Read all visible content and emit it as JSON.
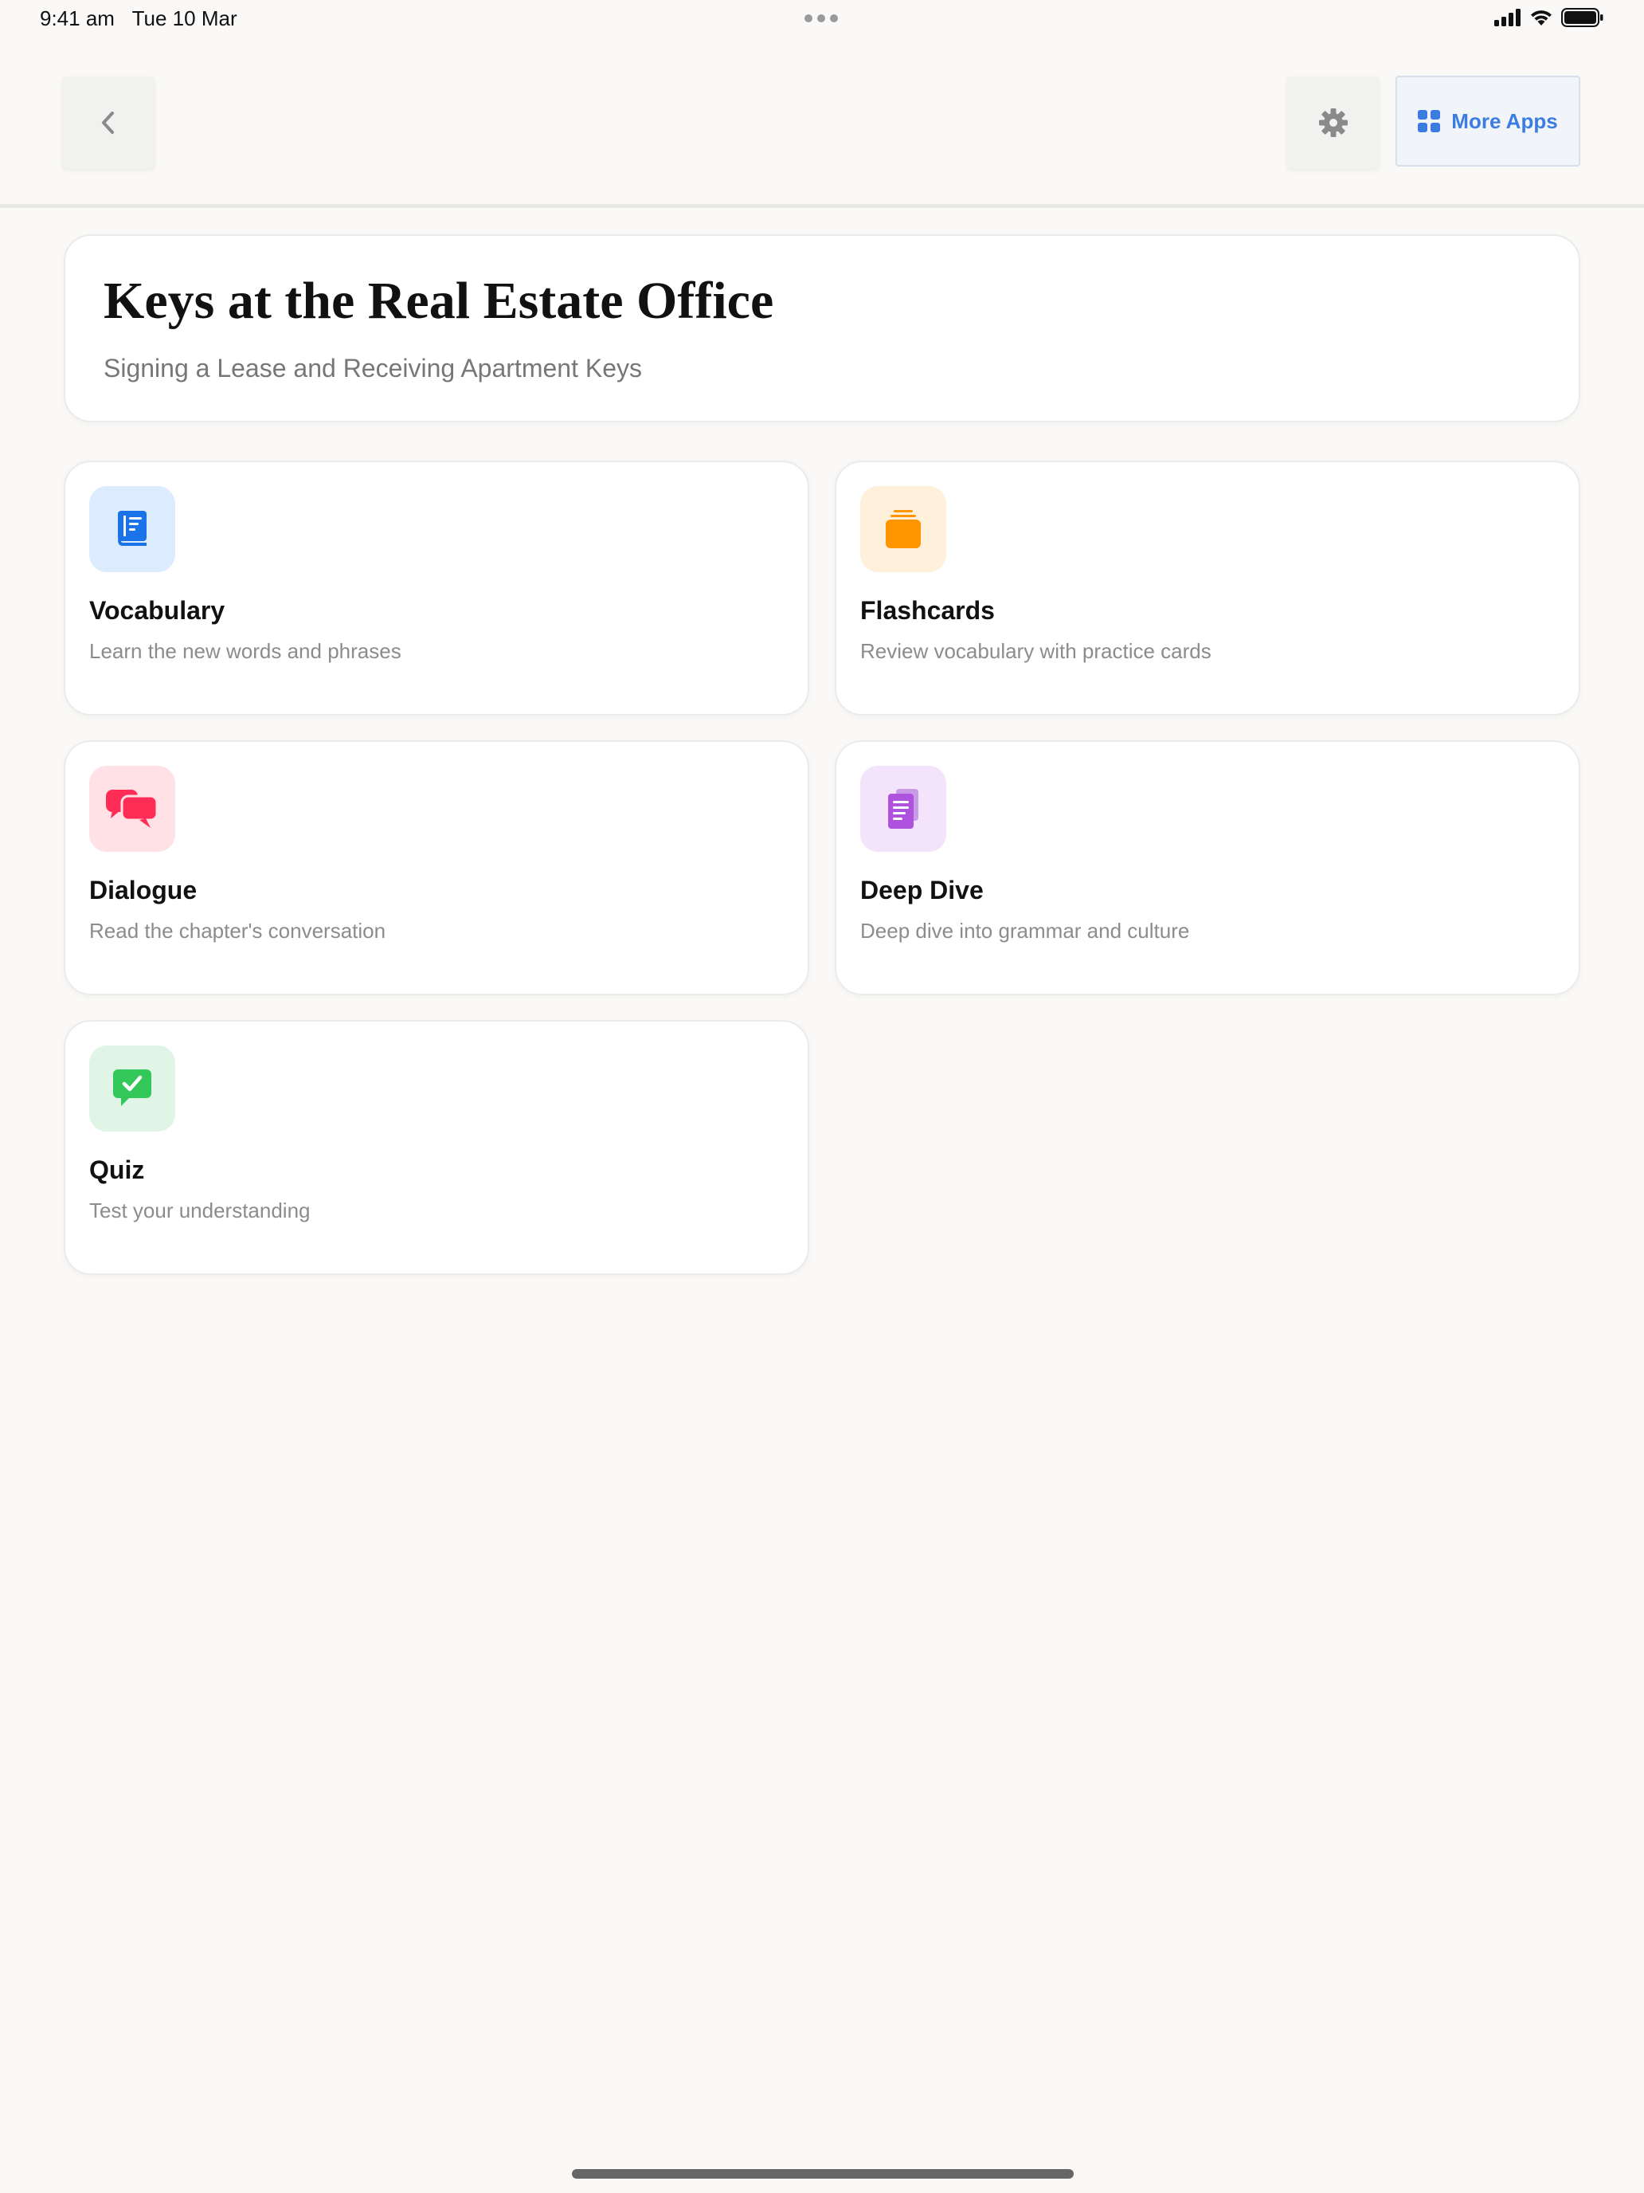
{
  "status_bar": {
    "time": "9:41 am",
    "date": "Tue 10 Mar"
  },
  "header": {
    "back_icon": "chevron-left-icon",
    "settings_icon": "gear-icon",
    "more_apps": {
      "icon": "grid-icon",
      "label": "More Apps",
      "color": "#3b7ce2"
    }
  },
  "lesson": {
    "title": "Keys at the Real Estate Office",
    "subtitle": "Signing a Lease and Receiving Apartment Keys"
  },
  "activities": [
    {
      "id": "vocabulary",
      "icon": "book-icon",
      "title": "Vocabulary",
      "description": "Learn the new words and phrases",
      "accent": "#1a73e8",
      "tile_bg": "#dcebfd"
    },
    {
      "id": "flashcards",
      "icon": "card-stack-icon",
      "title": "Flashcards",
      "description": "Review vocabulary with practice cards",
      "accent": "#ff9500",
      "tile_bg": "#fff0dc"
    },
    {
      "id": "dialogue",
      "icon": "speech-bubbles-icon",
      "title": "Dialogue",
      "description": "Read the chapter's conversation",
      "accent": "#ff2d55",
      "tile_bg": "#ffe1e6"
    },
    {
      "id": "deep-dive",
      "icon": "document-icon",
      "title": "Deep Dive",
      "description": "Deep dive into grammar and culture",
      "accent": "#af52de",
      "tile_bg": "#f3e4fb"
    },
    {
      "id": "quiz",
      "icon": "checkmark-bubble-icon",
      "title": "Quiz",
      "description": "Test your understanding",
      "accent": "#34c759",
      "tile_bg": "#e0f5e5"
    }
  ]
}
